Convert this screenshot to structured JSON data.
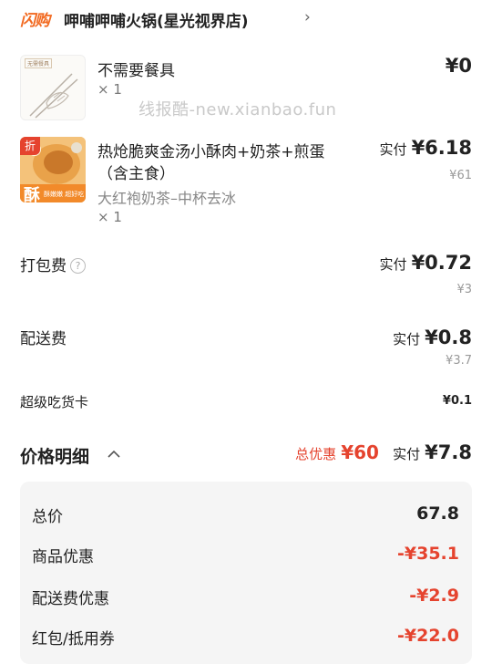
{
  "header": {
    "brand": "闪购",
    "store_name": "呷哺呷哺火锅(星光视界店)",
    "chevron": "›"
  },
  "watermark": "线报酷-new.xianbao.fun",
  "items": [
    {
      "thumb_label": "无需餐具",
      "title": "不需要餐具",
      "qty": "× 1",
      "price": "¥0"
    },
    {
      "badge": "折",
      "thumb_text": "酥",
      "thumb_caption": "酥嫩嫩 超好吃",
      "title_line1": "热炝脆爽金汤小酥肉+奶茶+煎蛋",
      "title_line2": "（含主食）",
      "spec": "大红袍奶茶–中杯去冰",
      "qty": "× 1",
      "paid_label": "实付",
      "paid_value": "¥6.18",
      "original": "¥61"
    }
  ],
  "fees": [
    {
      "label": "打包费",
      "help_icon": "?",
      "paid_label": "实付",
      "paid_value": "¥0.72",
      "original": "¥3"
    },
    {
      "label": "配送费",
      "paid_label": "实付",
      "paid_value": "¥0.8",
      "original": "¥3.7"
    },
    {
      "label": "超级吃货卡",
      "value": "¥0.1"
    }
  ],
  "price_detail": {
    "title": "价格明细",
    "toggle_icon": "chevron-up",
    "discount_label": "总优惠",
    "discount_value": "¥60",
    "paid_label": "实付",
    "paid_value": "¥7.8",
    "rows": [
      {
        "label": "总价",
        "value": "67.8"
      },
      {
        "label": "商品优惠",
        "value": "-¥35.1"
      },
      {
        "label": "配送费优惠",
        "value": "-¥2.9"
      },
      {
        "label": "红包/抵用券",
        "value": "-¥22.0"
      }
    ]
  },
  "colors": {
    "accent": "#f26a21",
    "discount": "#e5432e",
    "panel": "#f5f5f5"
  }
}
